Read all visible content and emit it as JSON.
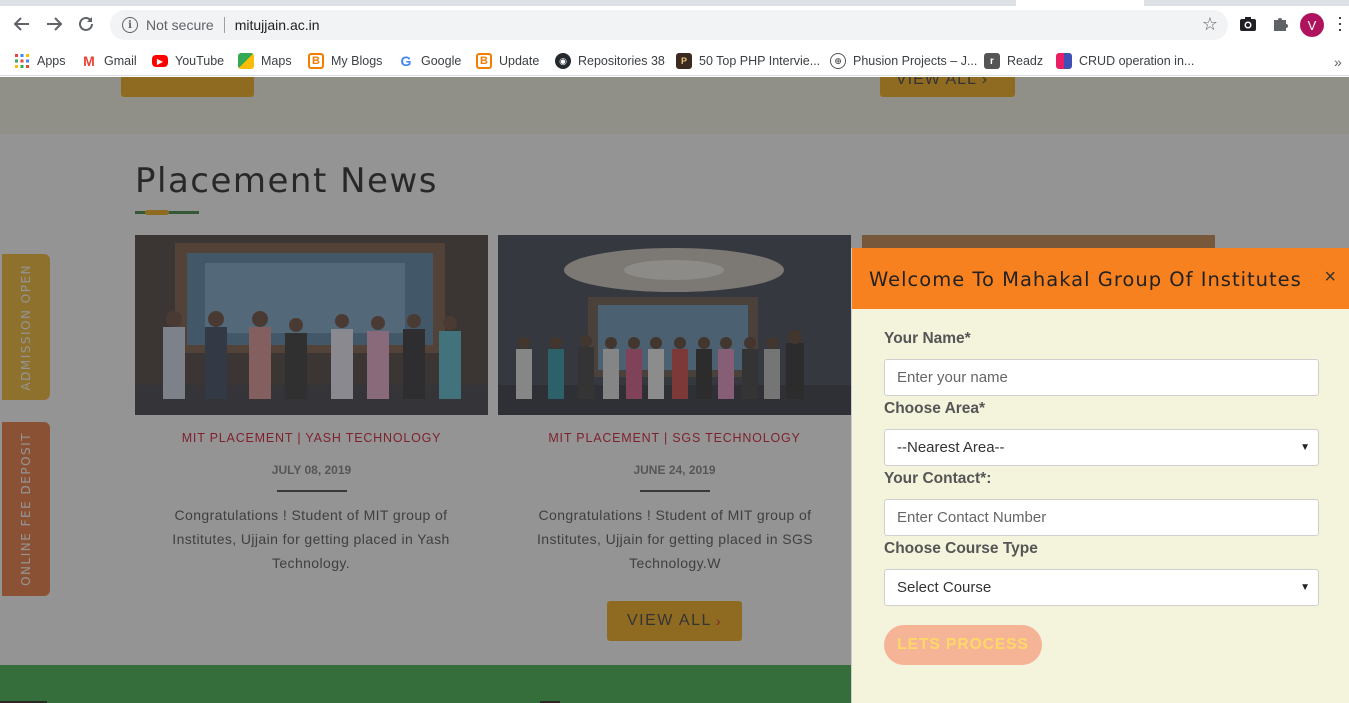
{
  "browser": {
    "security_label": "Not secure",
    "url": "mitujjain.ac.in",
    "avatar_letter": "V"
  },
  "bookmarks": [
    {
      "label": "Apps",
      "icon": "apps-grid-icon"
    },
    {
      "label": "Gmail",
      "icon": "gmail-icon"
    },
    {
      "label": "YouTube",
      "icon": "youtube-icon"
    },
    {
      "label": "Maps",
      "icon": "maps-icon"
    },
    {
      "label": "My Blogs",
      "icon": "blogger-icon"
    },
    {
      "label": "Google",
      "icon": "google-icon"
    },
    {
      "label": "Update",
      "icon": "blogger-icon"
    },
    {
      "label": "Repositories 38",
      "icon": "github-icon"
    },
    {
      "label": "50 Top PHP Intervie...",
      "icon": "php-site-icon"
    },
    {
      "label": "Phusion Projects – J...",
      "icon": "phusion-icon"
    },
    {
      "label": "Readz",
      "icon": "readz-icon"
    },
    {
      "label": "CRUD operation in...",
      "icon": "crud-site-icon"
    }
  ],
  "page": {
    "top_band_button_label": "VIEW ALL ›",
    "section_title": "Placement News",
    "news": [
      {
        "heading": "MIT PLACEMENT | YASH TECHNOLOGY",
        "date": "JULY 08, 2019",
        "text": "Congratulations ! Student of MIT group of Institutes, Ujjain for getting placed in Yash Technology."
      },
      {
        "heading": "MIT PLACEMENT | SGS TECHNOLOGY",
        "date": "JUNE 24, 2019",
        "text": "Congratulations ! Student of MIT group of Institutes, Ujjain for getting placed in SGS Technology.W"
      }
    ],
    "view_all_label": "VIEW ALL",
    "side_tabs": {
      "admission": "ADMISSION OPEN",
      "fee": "ONLINE FEE DEPOSIT"
    }
  },
  "modal": {
    "title": "Welcome To Mahakal Group Of Institutes",
    "close_symbol": "×",
    "name_label": "Your Name*",
    "name_placeholder": "Enter your name",
    "area_label": "Choose Area*",
    "area_selected": "--Nearest Area--",
    "contact_label": "Your Contact*:",
    "contact_placeholder": "Enter Contact Number",
    "course_label": "Choose Course Type",
    "course_selected": "Select Course",
    "submit_label": "LETS PROCESS"
  },
  "colors": {
    "accent_orange": "#f7811f",
    "button_yellow": "#f2a400",
    "heading_red": "#d0021b",
    "brand_green": "#2ea83a",
    "modal_bg": "#f4f3dc"
  }
}
